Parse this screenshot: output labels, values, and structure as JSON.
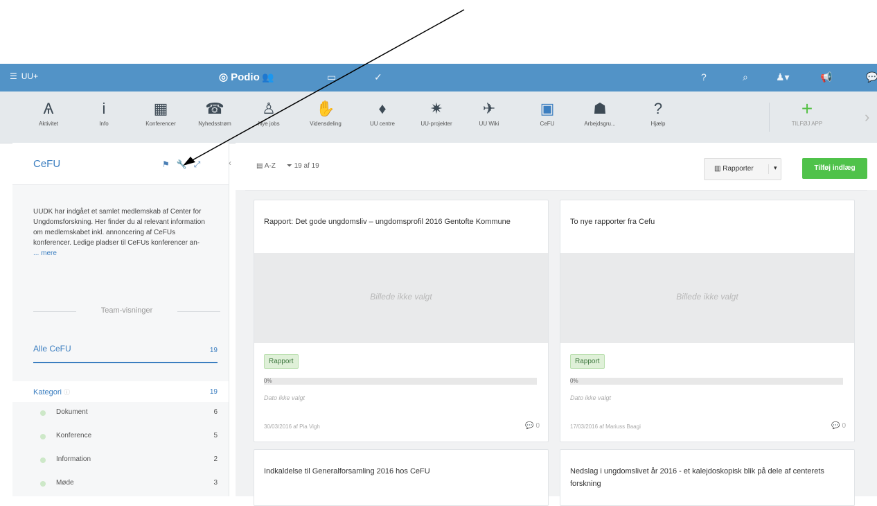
{
  "topbar": {
    "workspace": "UU+",
    "brand": "Podio",
    "icons": [
      "contacts-icon",
      "inbox-icon",
      "tasks-icon",
      "help-icon",
      "search-icon",
      "user-icon",
      "notifications-icon",
      "chat-icon"
    ]
  },
  "apps": [
    {
      "label": "Aktivitet",
      "icon": "activity-icon",
      "glyph": "Ѧ"
    },
    {
      "label": "Info",
      "icon": "info-icon",
      "glyph": "i"
    },
    {
      "label": "Konferencer",
      "icon": "conference-icon",
      "glyph": "▦"
    },
    {
      "label": "Nyhedsstrøm",
      "icon": "news-icon",
      "glyph": "☎"
    },
    {
      "label": "Nye jobs",
      "icon": "jobs-icon",
      "glyph": "♙"
    },
    {
      "label": "Vidensdeling",
      "icon": "knowledge-icon",
      "glyph": "✋"
    },
    {
      "label": "UU centre",
      "icon": "centres-icon",
      "glyph": "♦"
    },
    {
      "label": "UU-projekter",
      "icon": "projects-icon",
      "glyph": "✷"
    },
    {
      "label": "UU Wiki",
      "icon": "wiki-icon",
      "glyph": "✈"
    },
    {
      "label": "CeFU",
      "icon": "cefu-icon",
      "glyph": "▣"
    },
    {
      "label": "Arbejdsgru...",
      "icon": "workgroup-icon",
      "glyph": "☗"
    },
    {
      "label": "Hjælp",
      "icon": "help-icon",
      "glyph": "?"
    },
    {
      "label": "TILFØJ APP",
      "icon": "add-app-icon",
      "glyph": "+"
    }
  ],
  "sidebar": {
    "title": "CeFU",
    "description": "UUDK har indgået et samlet medlemskab af Center for Ungdomsforskning. Her finder du al relevant information om medlemskabet inkl. annoncering af CeFUs konferencer. Ledige pladser til CeFUs konferencer an-",
    "more_link": "... mere",
    "views_heading": "Team-visninger",
    "all_view": {
      "label": "Alle CeFU",
      "count": "19"
    },
    "category": {
      "label": "Kategori",
      "count": "19"
    },
    "category_items": [
      {
        "label": "Dokument",
        "count": "6"
      },
      {
        "label": "Konference",
        "count": "5"
      },
      {
        "label": "Information",
        "count": "2"
      },
      {
        "label": "Møde",
        "count": "3"
      }
    ]
  },
  "main": {
    "sort_label": "A-Z",
    "filter_label": "19 af 19",
    "report_button": "Rapporter",
    "add_button": "Tilføj indlæg",
    "cards": [
      {
        "title": "Rapport: Det gode ungdomsliv – ungdomsprofil 2016 Gentofte Kommune",
        "image_placeholder": "Billede ikke valgt",
        "tag": "Rapport",
        "progress": "0%",
        "date_placeholder": "Dato ikke valgt",
        "meta": "30/03/2016 af Pia Vigh",
        "comments": "0"
      },
      {
        "title": "To nye rapporter fra Cefu",
        "image_placeholder": "Billede ikke valgt",
        "tag": "Rapport",
        "progress": "0%",
        "date_placeholder": "Dato ikke valgt",
        "meta": "17/03/2016 af Mariuss Baagi",
        "comments": "0"
      },
      {
        "title": "Indkaldelse til Generalforsamling 2016 hos CeFU"
      },
      {
        "title": "Nedslag i ungdomslivet år 2016 - et kalejdoskopisk blik på dele af centerets forskning"
      }
    ]
  }
}
